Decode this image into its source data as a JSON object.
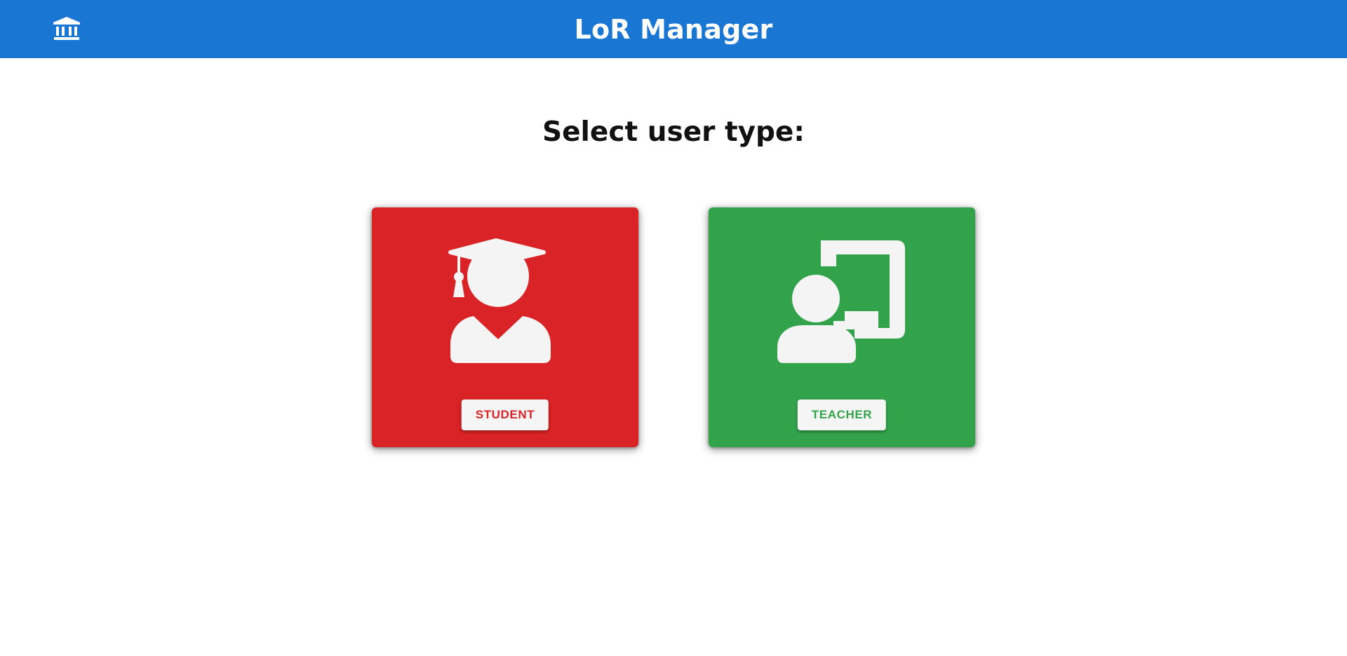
{
  "header": {
    "title": "LoR Manager",
    "home_icon": "bank-icon",
    "background_color": "#1976d2"
  },
  "main": {
    "heading": "Select user type:"
  },
  "cards": [
    {
      "id": "student",
      "label": "STUDENT",
      "icon": "graduate-icon",
      "background_color": "#d92326",
      "label_color": "#d92326"
    },
    {
      "id": "teacher",
      "label": "TEACHER",
      "icon": "teacher-board-icon",
      "background_color": "#33a34b",
      "label_color": "#33a34b"
    }
  ]
}
